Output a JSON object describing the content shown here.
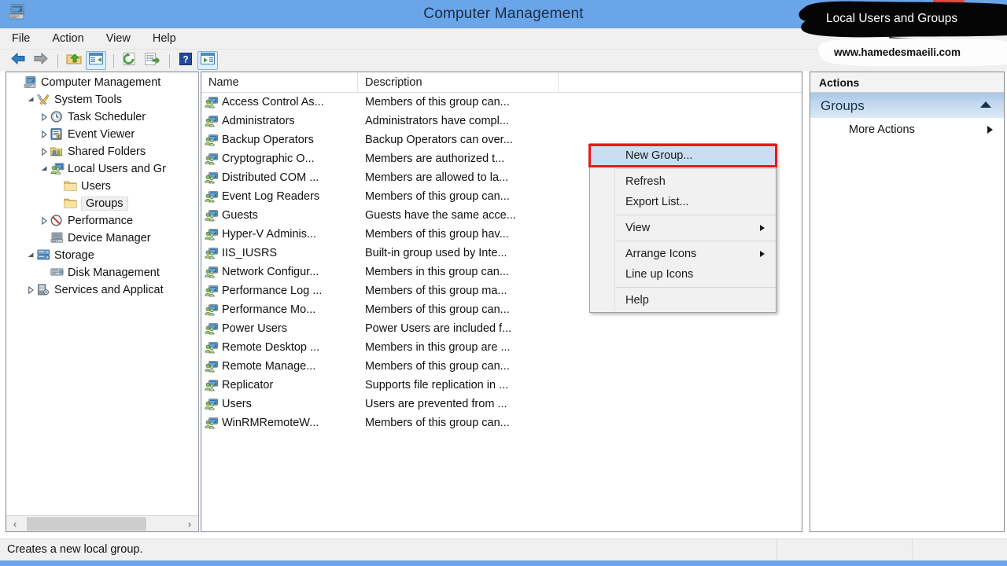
{
  "window": {
    "title": "Computer Management",
    "icon": "computer-management-icon"
  },
  "menubar": {
    "items": [
      {
        "label": "File",
        "name": "menu-file"
      },
      {
        "label": "Action",
        "name": "menu-action"
      },
      {
        "label": "View",
        "name": "menu-view"
      },
      {
        "label": "Help",
        "name": "menu-help"
      }
    ]
  },
  "toolbar": {
    "buttons": [
      {
        "icon": "back-arrow-icon",
        "checked": false
      },
      {
        "icon": "forward-arrow-icon",
        "checked": false
      },
      {
        "icon": "separator",
        "checked": false
      },
      {
        "icon": "up-folder-icon",
        "checked": false
      },
      {
        "icon": "show-hide-tree-icon",
        "checked": true
      },
      {
        "icon": "separator",
        "checked": false
      },
      {
        "icon": "refresh-icon",
        "checked": false
      },
      {
        "icon": "export-list-icon",
        "checked": false
      },
      {
        "icon": "separator",
        "checked": false
      },
      {
        "icon": "help-icon",
        "checked": false
      },
      {
        "icon": "show-action-pane-icon",
        "checked": true
      }
    ]
  },
  "tree": {
    "nodes": [
      {
        "label": "Computer Management",
        "indent": 0,
        "expander": "none",
        "icon": "computer-management-icon",
        "selected": false
      },
      {
        "label": "System Tools",
        "indent": 1,
        "expander": "expanded",
        "icon": "system-tools-icon",
        "selected": false
      },
      {
        "label": "Task Scheduler",
        "indent": 2,
        "expander": "collapsed",
        "icon": "clock-icon",
        "selected": false
      },
      {
        "label": "Event Viewer",
        "indent": 2,
        "expander": "collapsed",
        "icon": "event-viewer-icon",
        "selected": false
      },
      {
        "label": "Shared Folders",
        "indent": 2,
        "expander": "collapsed",
        "icon": "shared-folders-icon",
        "selected": false
      },
      {
        "label": "Local Users and Gr",
        "indent": 2,
        "expander": "expanded",
        "icon": "local-users-groups-icon",
        "selected": false
      },
      {
        "label": "Users",
        "indent": 3,
        "expander": "none",
        "icon": "folder-icon",
        "selected": false
      },
      {
        "label": "Groups",
        "indent": 3,
        "expander": "none",
        "icon": "folder-icon",
        "selected": true
      },
      {
        "label": "Performance",
        "indent": 2,
        "expander": "collapsed",
        "icon": "performance-icon",
        "selected": false
      },
      {
        "label": "Device Manager",
        "indent": 2,
        "expander": "none",
        "icon": "device-manager-icon",
        "selected": false
      },
      {
        "label": "Storage",
        "indent": 1,
        "expander": "expanded",
        "icon": "storage-icon",
        "selected": false
      },
      {
        "label": "Disk Management",
        "indent": 2,
        "expander": "none",
        "icon": "disk-management-icon",
        "selected": false
      },
      {
        "label": "Services and Applicat",
        "indent": 1,
        "expander": "collapsed",
        "icon": "services-icon",
        "selected": false
      }
    ],
    "hscroll": {
      "left_arrow": "‹",
      "right_arrow": "›"
    }
  },
  "list": {
    "columns": [
      "Name",
      "Description",
      ""
    ],
    "rows": [
      {
        "name": "Access Control As...",
        "description": "Members of this group can..."
      },
      {
        "name": "Administrators",
        "description": "Administrators have compl..."
      },
      {
        "name": "Backup Operators",
        "description": "Backup Operators can over..."
      },
      {
        "name": "Cryptographic O...",
        "description": "Members are authorized t..."
      },
      {
        "name": "Distributed COM ...",
        "description": "Members are allowed to la..."
      },
      {
        "name": "Event Log Readers",
        "description": "Members of this group can..."
      },
      {
        "name": "Guests",
        "description": "Guests have the same acce..."
      },
      {
        "name": "Hyper-V Adminis...",
        "description": "Members of this group hav..."
      },
      {
        "name": "IIS_IUSRS",
        "description": "Built-in group used by Inte..."
      },
      {
        "name": "Network Configur...",
        "description": "Members in this group can..."
      },
      {
        "name": "Performance Log ...",
        "description": "Members of this group ma..."
      },
      {
        "name": "Performance Mo...",
        "description": "Members of this group can..."
      },
      {
        "name": "Power Users",
        "description": "Power Users are included f..."
      },
      {
        "name": "Remote Desktop ...",
        "description": "Members in this group are ..."
      },
      {
        "name": "Remote Manage...",
        "description": "Members of this group can..."
      },
      {
        "name": "Replicator",
        "description": "Supports file replication in ..."
      },
      {
        "name": "Users",
        "description": "Users are prevented from ..."
      },
      {
        "name": "WinRMRemoteW...",
        "description": "Members of this group can..."
      }
    ],
    "row_icon": "group-icon"
  },
  "actions": {
    "title": "Actions",
    "section": {
      "label": "Groups",
      "collapse_icon": "chevron-up-icon"
    },
    "items": [
      {
        "label": "More Actions",
        "submenu": true,
        "name": "action-more-actions"
      }
    ]
  },
  "context_menu": {
    "items": [
      {
        "label": "New Group...",
        "highlighted": true,
        "submenu": false,
        "separator_after": true,
        "name": "ctx-new-group"
      },
      {
        "label": "Refresh",
        "highlighted": false,
        "submenu": false,
        "separator_after": false,
        "name": "ctx-refresh"
      },
      {
        "label": "Export List...",
        "highlighted": false,
        "submenu": false,
        "separator_after": true,
        "name": "ctx-export-list"
      },
      {
        "label": "View",
        "highlighted": false,
        "submenu": true,
        "separator_after": true,
        "name": "ctx-view"
      },
      {
        "label": "Arrange Icons",
        "highlighted": false,
        "submenu": true,
        "separator_after": false,
        "name": "ctx-arrange-icons"
      },
      {
        "label": "Line up Icons",
        "highlighted": false,
        "submenu": false,
        "separator_after": true,
        "name": "ctx-line-up-icons"
      },
      {
        "label": "Help",
        "highlighted": false,
        "submenu": false,
        "separator_after": false,
        "name": "ctx-help"
      }
    ],
    "highlight_color": "#e8191b"
  },
  "statusbar": {
    "message": "Creates a new local group."
  },
  "overlay": {
    "annotation_text": "Local Users and Groups",
    "website": "www.hamedesmaeili.com"
  },
  "colors": {
    "titlebar": "#6aa5e9",
    "title_text": "#1b2c42",
    "chrome": "#f0f0f0",
    "selection": "#cbdef1",
    "highlight_red": "#e8191b",
    "actions_section": "#a8c6e5"
  }
}
